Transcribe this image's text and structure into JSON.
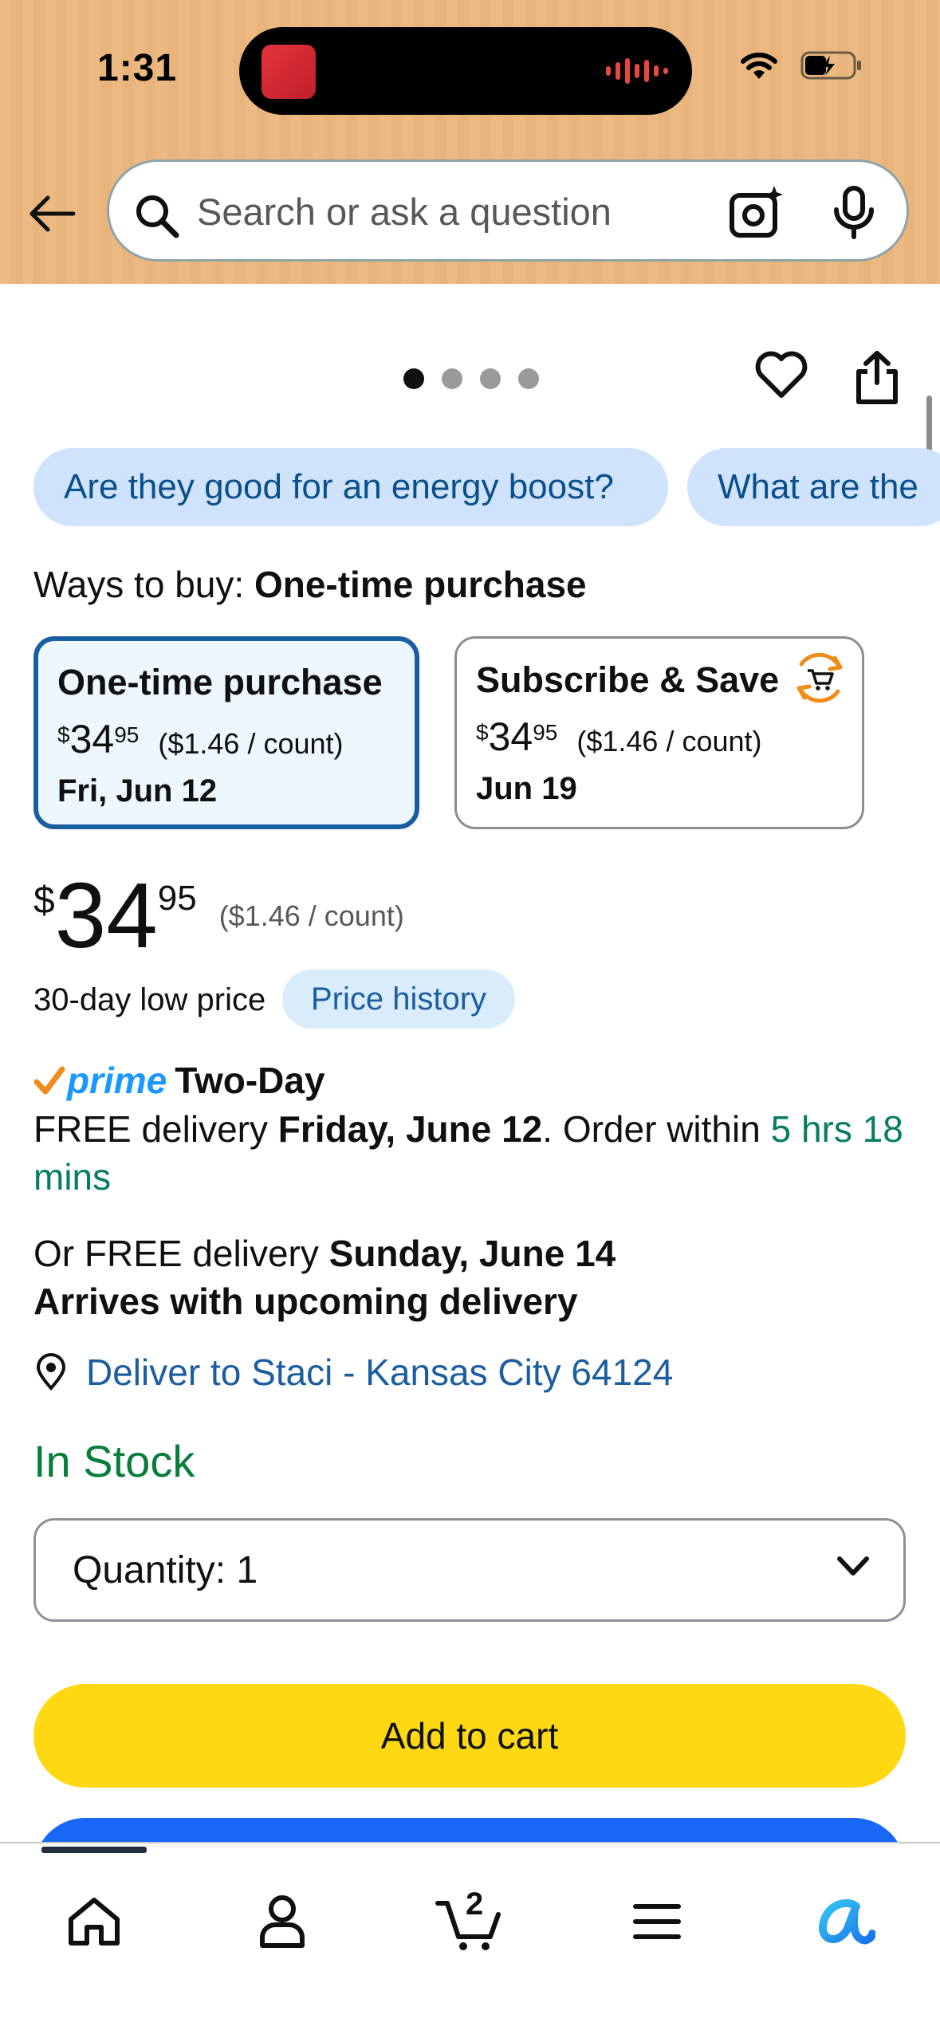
{
  "status_bar": {
    "time": "1:31"
  },
  "search": {
    "placeholder": "Search or ask a question"
  },
  "image_carousel": {
    "dot_count": 4,
    "active_index": 0
  },
  "suggestion_chips": [
    {
      "label": "Are they good for an energy boost?"
    },
    {
      "label": "What are the"
    }
  ],
  "ways_to_buy": {
    "label": "Ways to buy:",
    "selected": "One-time purchase",
    "options": [
      {
        "title": "One-time purchase",
        "currency": "$",
        "whole": "34",
        "fraction": "95",
        "unit_price": "($1.46 / count)",
        "date": "Fri, Jun 12"
      },
      {
        "title": "Subscribe & Save",
        "currency": "$",
        "whole": "34",
        "fraction": "95",
        "unit_price": "($1.46 / count)",
        "date": "Jun 19"
      }
    ]
  },
  "price": {
    "currency": "$",
    "whole": "34",
    "fraction": "95",
    "unit_price": "($1.46 / count)"
  },
  "low_price_label": "30-day low price",
  "price_history_label": "Price history",
  "delivery": {
    "prime_label": "prime",
    "speed": "Two-Day",
    "line1_prefix": "FREE delivery ",
    "line1_date": "Friday, June 12",
    "line1_mid": ". Order within ",
    "line1_countdown": "5 hrs 18 mins",
    "line2_prefix": "Or FREE delivery ",
    "line2_date": "Sunday, June 14",
    "line2_note": "Arrives with upcoming delivery",
    "deliver_to": "Deliver to Staci - Kansas City 64124"
  },
  "stock_status": "In Stock",
  "quantity": {
    "label": "Quantity:",
    "value": "1"
  },
  "add_to_cart_label": "Add to cart",
  "bottom_nav": {
    "cart_count": "2"
  },
  "colors": {
    "header_bg": "#ecb982",
    "add_to_cart": "#ffd814",
    "buy_now": "#1a66f7",
    "link_blue": "#1b5d9e",
    "stock_green": "#067d39",
    "prime_blue": "#1a98ff"
  }
}
